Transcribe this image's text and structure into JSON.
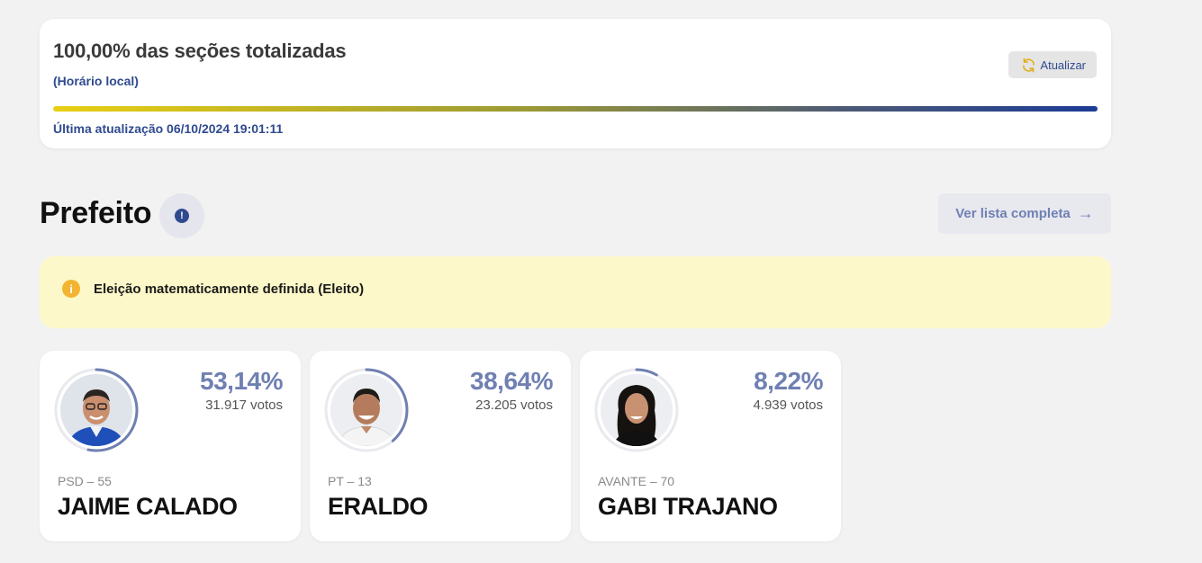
{
  "status": {
    "title": "100,00% das seções totalizadas",
    "subtitle": "(Horário local)",
    "refresh_label": "Atualizar",
    "progress_percent": 100,
    "last_update": "Última atualização 06/10/2024 19:01:11"
  },
  "section": {
    "title": "Prefeito",
    "info_icon": "!",
    "full_list_label": "Ver lista completa",
    "full_list_arrow": "→"
  },
  "alert": {
    "icon": "i",
    "text": "Eleição matematicamente definida (Eleito)"
  },
  "candidates": [
    {
      "percent_label": "53,14%",
      "percent_value": 53.14,
      "votes": "31.917 votos",
      "party": "PSD – 55",
      "name": "JAIME CALADO"
    },
    {
      "percent_label": "38,64%",
      "percent_value": 38.64,
      "votes": "23.205 votos",
      "party": "PT – 13",
      "name": "ERALDO"
    },
    {
      "percent_label": "8,22%",
      "percent_value": 8.22,
      "votes": "4.939 votos",
      "party": "AVANTE – 70",
      "name": "GABI TRAJANO"
    }
  ],
  "colors": {
    "accent": "#2f4a8f",
    "percent": "#6f80b2",
    "alert_bg": "#fdf8c9",
    "alert_icon": "#f3b431",
    "refresh_icon": "#e0b020"
  }
}
